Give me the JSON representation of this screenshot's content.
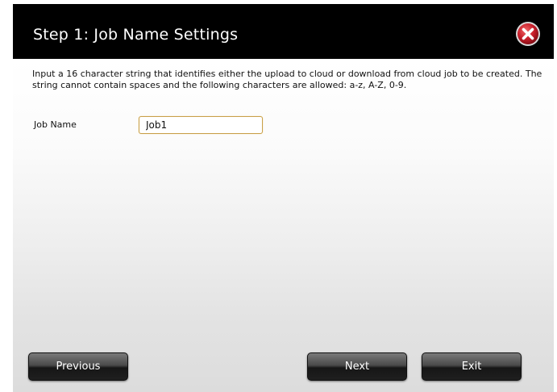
{
  "dialog": {
    "title": "Step 1: Job Name Settings",
    "close_icon": "close-x-icon",
    "description": "Input a 16 character string that identifies either the upload to cloud or download from cloud job to be created. The string cannot contain spaces and the following characters are allowed: a-z, A-Z, 0-9.",
    "job_name_label": "Job Name",
    "job_name_value": "Job1"
  },
  "buttons": {
    "previous_label": "Previous",
    "next_label": "Next",
    "exit_label": "Exit"
  },
  "colors": {
    "titlebar": "#000000",
    "close_button": "#c81e2a",
    "input_border": "#c9a04a",
    "button_dark": "#1f1f1f"
  }
}
